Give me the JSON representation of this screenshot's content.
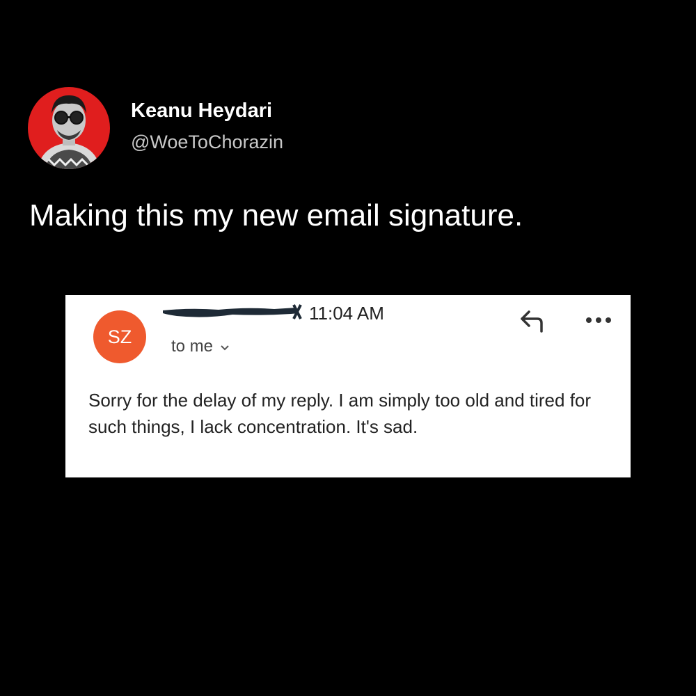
{
  "tweet": {
    "author": {
      "display_name": "Keanu Heydari",
      "handle": "@WoeToChorazin",
      "avatar_icon": "profile-photo"
    },
    "text": "Making this my new email signature."
  },
  "email": {
    "sender_initials": "SZ",
    "sender_avatar_color": "#ef5a2e",
    "sender_name": "",
    "time": "11:04 AM",
    "recipient": "to me",
    "icons": {
      "reply": "reply-icon",
      "more": "more-options-icon",
      "expand": "chevron-down-icon"
    },
    "body": "Sorry for the delay of my reply. I am simply too old and tired for such things, I lack concentration. It's sad."
  },
  "colors": {
    "background": "#000000",
    "card": "#ffffff",
    "accent": "#ef5a2e"
  }
}
